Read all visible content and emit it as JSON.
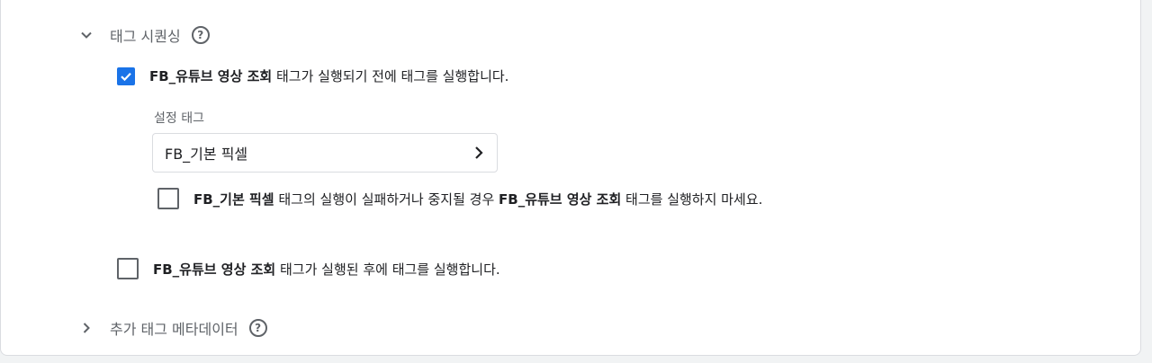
{
  "sequencing": {
    "title": "태그 시퀀싱",
    "help": "?",
    "fire_before": {
      "checked": true,
      "tag_name": "FB_유튜브 영상 조회",
      "suffix": " 태그가 실행되기 전에 태그를 실행합니다."
    },
    "setup_tag": {
      "label": "설정 태그",
      "value": "FB_기본 픽셀"
    },
    "dont_fire_on_fail": {
      "checked": false,
      "tag_name": "FB_기본 픽셀",
      "middle": " 태그의 실행이 실패하거나 중지될 경우 ",
      "tag_name_2": "FB_유튜브 영상 조회",
      "suffix": " 태그를 실행하지 마세요."
    },
    "fire_after": {
      "checked": false,
      "tag_name": "FB_유튜브 영상 조회",
      "suffix": " 태그가 실행된 후에 태그를 실행합니다."
    }
  },
  "metadata": {
    "title": "추가 태그 메타데이터",
    "help": "?"
  },
  "colors": {
    "accent": "#1a73e8",
    "text": "#202124",
    "secondary": "#5f6368",
    "border": "#dadce0"
  }
}
